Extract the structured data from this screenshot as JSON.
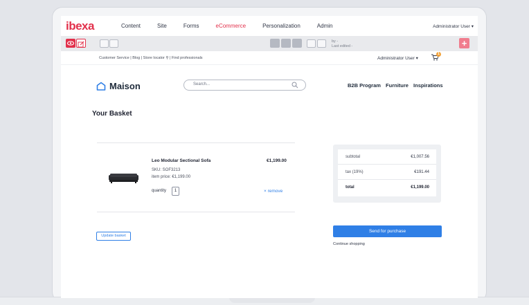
{
  "admin": {
    "logo": "ibexa",
    "nav": [
      "Content",
      "Site",
      "Forms",
      "eCommerce",
      "Personalization",
      "Admin"
    ],
    "active_nav": "eCommerce",
    "user": "Administrator User ▾",
    "accent": "#e2304b"
  },
  "toolbar": {
    "meta_by": "by -",
    "meta_edited": "Last edited -"
  },
  "shop": {
    "util_links": "Customer Service  |  Blog  |  Store locator ⚲  |  Find professionals",
    "user": "Administrator User ▾",
    "cart_count": "1",
    "brand": "Maison",
    "search_placeholder": "Search...",
    "nav": [
      "B2B Program",
      "Furniture",
      "Inspirations"
    ]
  },
  "basket": {
    "title": "Your Basket",
    "item": {
      "name": "Leo Modular Sectional Sofa",
      "sku": "SKU: SOF3213",
      "unit_price": "item price: €1,199.00",
      "quantity_label": "quantity",
      "quantity": "1",
      "price": "€1,199.00",
      "remove": "× remove"
    },
    "update_button": "Update basket",
    "summary": [
      {
        "label": "subtotal",
        "value": "€1,007.56"
      },
      {
        "label": "tax (19%)",
        "value": "€191.44"
      },
      {
        "label": "total",
        "value": "€1,199.00"
      }
    ],
    "send_button": "Send for purchase",
    "continue": "Continue shopping",
    "primary_color": "#2f7fe6"
  }
}
